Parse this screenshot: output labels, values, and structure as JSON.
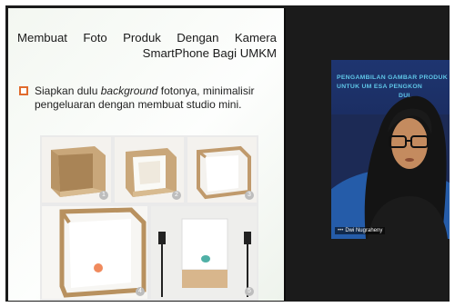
{
  "slide": {
    "title": "Membuat Foto Produk Dengan Kamera SmartPhone Bagi UMKM",
    "bullet_text_before": "Siapkan dulu ",
    "bullet_text_italic": "background",
    "bullet_text_after": " fotonya, minimalisir pengeluaran dengan membuat studio mini.",
    "steps": [
      "1",
      "2",
      "3",
      "4",
      "5"
    ]
  },
  "video": {
    "banner_line_1": "PENGAMBILAN GAMBAR PRODUK",
    "banner_line_2": "UNTUK UM   ESA PENGKON",
    "banner_line_3": "DUL",
    "participant_name": "Dwi Nugraheny",
    "dots": "•••"
  },
  "colors": {
    "bullet": "#e06b2d",
    "banner_text": "#5fc6e8",
    "banner_bg": "#1e3570",
    "curve": "#2765b8"
  }
}
